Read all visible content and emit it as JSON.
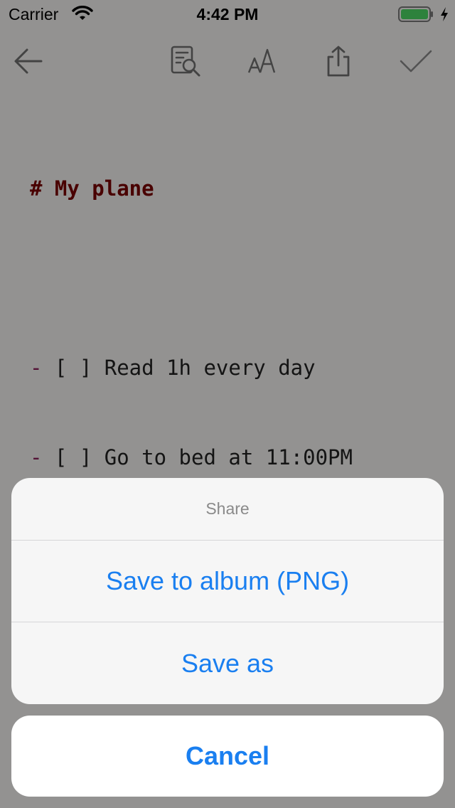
{
  "status_bar": {
    "carrier": "Carrier",
    "time": "4:42 PM",
    "battery_color": "#4cd964"
  },
  "toolbar": {
    "icons": [
      "back-arrow-icon",
      "preview-search-icon",
      "font-size-icon",
      "share-icon",
      "done-check-icon"
    ]
  },
  "editor": {
    "heading": "# My plane",
    "todos": [
      {
        "dash": "-",
        "text": " [ ] Read 1h every day"
      },
      {
        "dash": "-",
        "text": " [ ] Go to bed at 11:00PM"
      }
    ]
  },
  "action_sheet": {
    "title": "Share",
    "actions": [
      {
        "label": "Save to album (PNG)"
      },
      {
        "label": "Save as"
      }
    ],
    "cancel_label": "Cancel",
    "accent_color": "#1a7ff0"
  }
}
